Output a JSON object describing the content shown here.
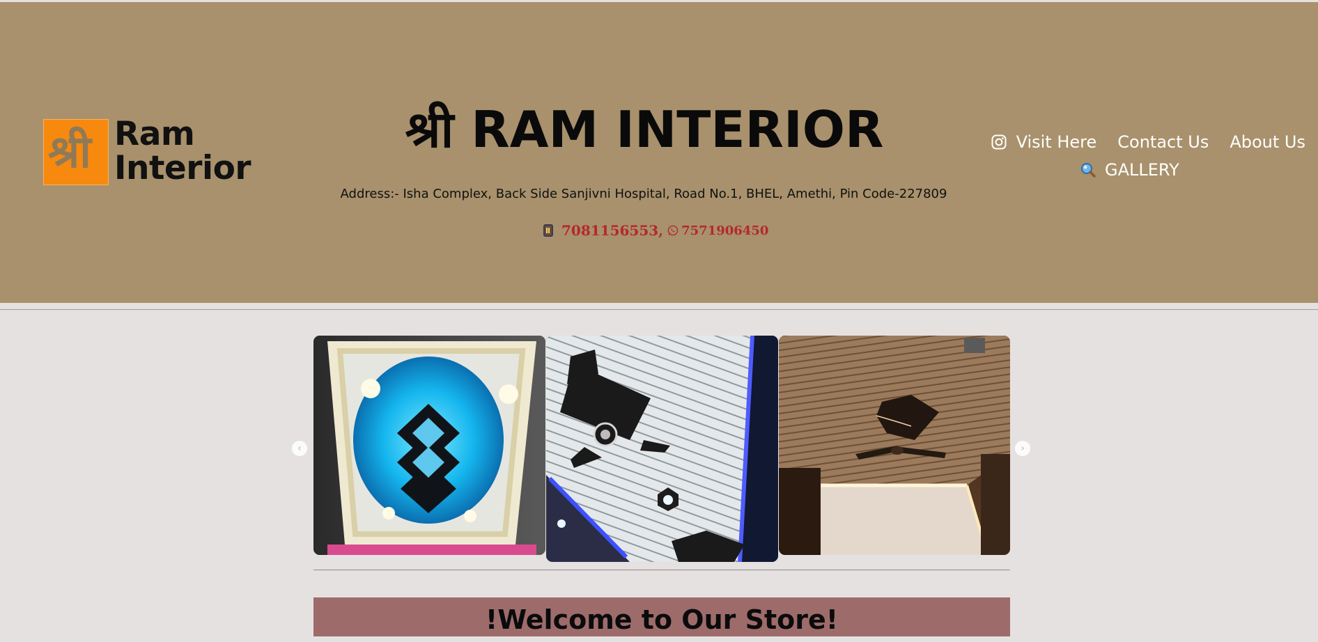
{
  "header": {
    "logo": {
      "glyph": "श्री",
      "line1": "Ram",
      "line2": "Interior"
    },
    "title": "श्री RAM INTERIOR",
    "address": "Address:- Isha Complex, Back Side Sanjivni Hospital, Road No.1, BHEL, Amethi, Pin Code-227809",
    "phone_primary": "7081156553,",
    "phone_whatsapp": "7571906450",
    "accent_color": "#b4282c",
    "background_color": "#a8916c"
  },
  "nav": {
    "visit_label": "Visit Here",
    "contact_label": "Contact Us",
    "about_label": "About Us",
    "gallery_label": "GALLERY",
    "icons": [
      "instagram-icon",
      "magnifier-icon"
    ]
  },
  "carousel": {
    "slides": [
      {
        "name": "ceiling-design-blue-diamond"
      },
      {
        "name": "ceiling-design-white-panel-fan"
      },
      {
        "name": "ceiling-design-wood-panel-fan"
      }
    ],
    "prev_icon": "chevron-left-icon",
    "next_icon": "chevron-right-icon"
  },
  "welcome": {
    "text": "!Welcome to Our Store!",
    "background_color": "#9e6b6b"
  }
}
